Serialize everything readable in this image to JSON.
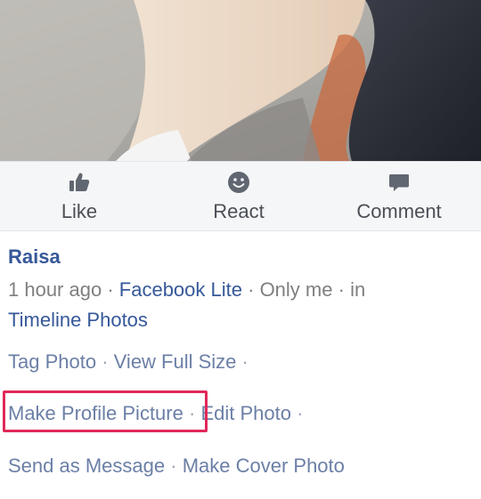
{
  "actions": {
    "like_label": "Like",
    "react_label": "React",
    "comment_label": "Comment",
    "like_icon": "thumbs-up-icon",
    "react_icon": "smiley-icon",
    "comment_icon": "speech-bubble-icon"
  },
  "post": {
    "author": "Raisa",
    "time": "1 hour ago",
    "app": "Facebook Lite",
    "privacy": "Only me",
    "in_word": "in",
    "album": "Timeline Photos",
    "separator": "·"
  },
  "options": {
    "tag_photo": "Tag Photo",
    "view_full_size": "View Full Size",
    "make_profile_picture": "Make Profile Picture",
    "edit_photo": "Edit Photo",
    "send_as_message": "Send as Message",
    "make_cover_photo": "Make Cover Photo"
  },
  "colors": {
    "link_blue": "#365899",
    "highlight": "#e0295a",
    "action_bar": "#f5f6f7"
  }
}
